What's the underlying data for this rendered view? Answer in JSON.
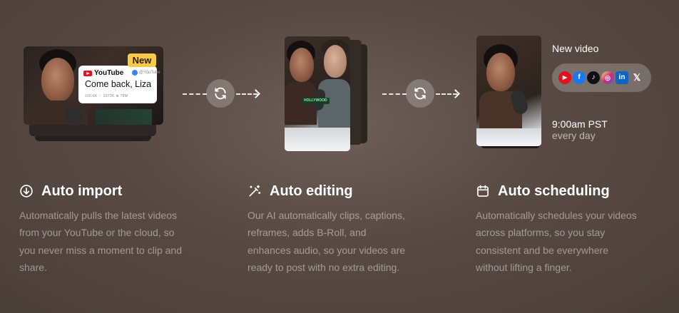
{
  "import_visual": {
    "badge": "New",
    "platform": "YouTube",
    "handle": "@YouTube",
    "video_title": "Come back, Liza",
    "stats": "100.6K   ♡ 3372K   ⊕ 78M"
  },
  "editing_visual": {
    "caption_tag": "HOLLYWOOD"
  },
  "scheduling_visual": {
    "label": "New video",
    "time": "9:00am PST",
    "frequency": "every day",
    "platforms": [
      "YouTube",
      "Facebook",
      "TikTok",
      "Instagram",
      "LinkedIn",
      "X"
    ]
  },
  "features": [
    {
      "icon": "download-circle-icon",
      "title": "Auto import",
      "description": "Automatically pulls the latest videos from your YouTube or the cloud, so you never miss a moment to clip and share."
    },
    {
      "icon": "magic-wand-icon",
      "title": "Auto editing",
      "description": "Our AI automatically clips, captions, reframes, adds B-Roll, and enhances audio, so your videos are ready to post with no extra editing."
    },
    {
      "icon": "calendar-icon",
      "title": "Auto scheduling",
      "description": "Automatically schedules your videos across platforms, so you stay consistent and be everywhere without lifting a finger."
    }
  ],
  "colors": {
    "badge": "#f7c948",
    "youtube": "#e4101b",
    "facebook": "#1877f2",
    "linkedin": "#0a66c2",
    "instagram": "#d62976"
  }
}
